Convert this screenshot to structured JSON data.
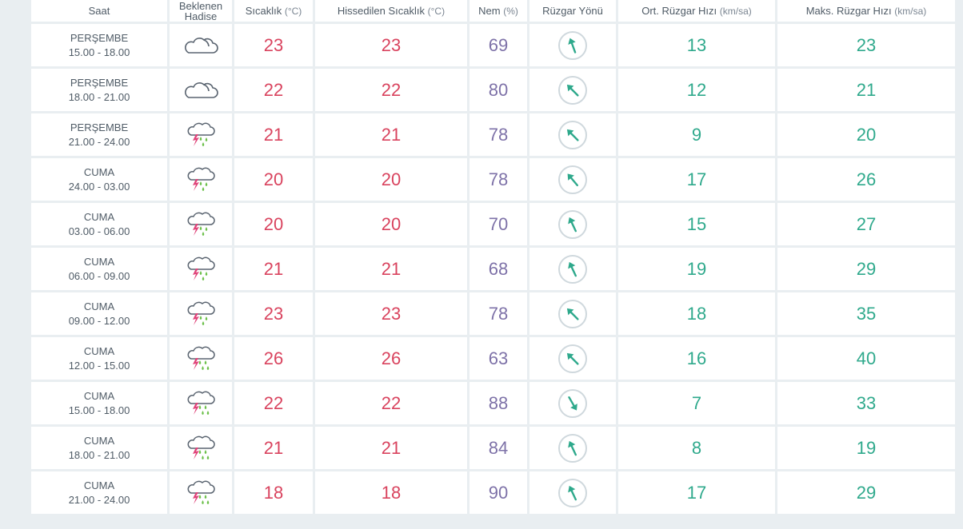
{
  "headers": {
    "saat": "Saat",
    "hadise_line1": "Beklenen",
    "hadise_line2": "Hadise",
    "sicaklik": "Sıcaklık",
    "sicaklik_unit": "(°C)",
    "hissedilen": "Hissedilen Sıcaklık",
    "hissedilen_unit": "(°C)",
    "nem": "Nem",
    "nem_unit": "(%)",
    "ruzgar_yonu": "Rüzgar Yönü",
    "ort_ruzgar": "Ort. Rüzgar Hızı",
    "ort_ruzgar_unit": "(km/sa)",
    "maks_ruzgar": "Maks. Rüzgar Hızı",
    "maks_ruzgar_unit": "(km/sa)"
  },
  "colors": {
    "temp": "#d9435e",
    "humidity": "#7e72a8",
    "wind": "#2fa98c",
    "arrow": "#2fa98c",
    "cloud_outline": "#5a6470",
    "lightning": "#e0447a",
    "rain_drop": "#6cc04a"
  },
  "rows": [
    {
      "day": "PERŞEMBE",
      "range": "15.00 - 18.00",
      "icon": "cloudy-icon",
      "temp": "23",
      "feels": "23",
      "hum": "69",
      "dir": 340,
      "avg": "13",
      "max": "23"
    },
    {
      "day": "PERŞEMBE",
      "range": "18.00 - 21.00",
      "icon": "cloudy-icon",
      "temp": "22",
      "feels": "22",
      "hum": "80",
      "dir": 315,
      "avg": "12",
      "max": "21"
    },
    {
      "day": "PERŞEMBE",
      "range": "21.00 - 24.00",
      "icon": "thunderstorm-rain-icon",
      "temp": "21",
      "feels": "21",
      "hum": "78",
      "dir": 315,
      "avg": "9",
      "max": "20"
    },
    {
      "day": "CUMA",
      "range": "24.00 - 03.00",
      "icon": "thunderstorm-rain-icon",
      "temp": "20",
      "feels": "20",
      "hum": "78",
      "dir": 320,
      "avg": "17",
      "max": "26"
    },
    {
      "day": "CUMA",
      "range": "03.00 - 06.00",
      "icon": "thunderstorm-rain-icon",
      "temp": "20",
      "feels": "20",
      "hum": "70",
      "dir": 335,
      "avg": "15",
      "max": "27"
    },
    {
      "day": "CUMA",
      "range": "06.00 - 09.00",
      "icon": "thunderstorm-rain-icon",
      "temp": "21",
      "feels": "21",
      "hum": "68",
      "dir": 335,
      "avg": "19",
      "max": "29"
    },
    {
      "day": "CUMA",
      "range": "09.00 - 12.00",
      "icon": "thunderstorm-rain-icon",
      "temp": "23",
      "feels": "23",
      "hum": "78",
      "dir": 315,
      "avg": "18",
      "max": "35"
    },
    {
      "day": "CUMA",
      "range": "12.00 - 15.00",
      "icon": "thunderstorm-heavy-rain-icon",
      "temp": "26",
      "feels": "26",
      "hum": "63",
      "dir": 315,
      "avg": "16",
      "max": "40"
    },
    {
      "day": "CUMA",
      "range": "15.00 - 18.00",
      "icon": "thunderstorm-heavy-rain-icon",
      "temp": "22",
      "feels": "22",
      "hum": "88",
      "dir": 150,
      "avg": "7",
      "max": "33"
    },
    {
      "day": "CUMA",
      "range": "18.00 - 21.00",
      "icon": "thunderstorm-heavy-rain-icon",
      "temp": "21",
      "feels": "21",
      "hum": "84",
      "dir": 335,
      "avg": "8",
      "max": "19"
    },
    {
      "day": "CUMA",
      "range": "21.00 - 24.00",
      "icon": "thunderstorm-heavy-rain-icon",
      "temp": "18",
      "feels": "18",
      "hum": "90",
      "dir": 335,
      "avg": "17",
      "max": "29"
    }
  ]
}
